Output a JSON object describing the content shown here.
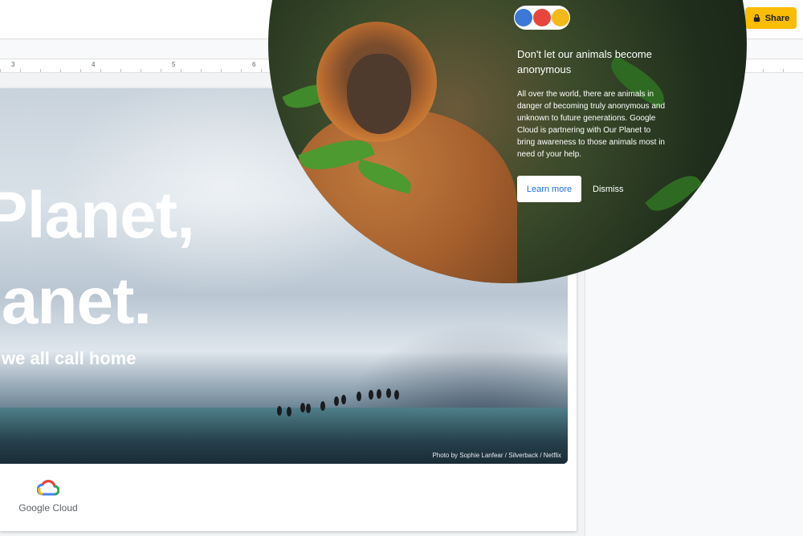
{
  "toolbar": {
    "share_label": "Share"
  },
  "ruler": {
    "ticks": [
      "3",
      "4",
      "5",
      "6"
    ]
  },
  "slide": {
    "headline_line1": "Planet,",
    "headline_line2": "lanet.",
    "subtitle": "we all call home",
    "photo_credit": "Photo by Sophie Lanfear / Silverback / Netflix",
    "footer_logo_text": "Google Cloud"
  },
  "promo": {
    "title": "Don't let our animals become anonymous",
    "body": "All over the world, there are animals in danger of becoming truly anonymous and unknown to future generations. Google Cloud is partnering with Our Planet to bring awareness to those animals most in need of your help.",
    "learn_more_label": "Learn more",
    "dismiss_label": "Dismiss",
    "badge_colors": [
      "#3b78d8",
      "#e8453c",
      "#f3b81a"
    ]
  },
  "colors": {
    "accent": "#fbbc04",
    "link_blue": "#1a73e8"
  }
}
